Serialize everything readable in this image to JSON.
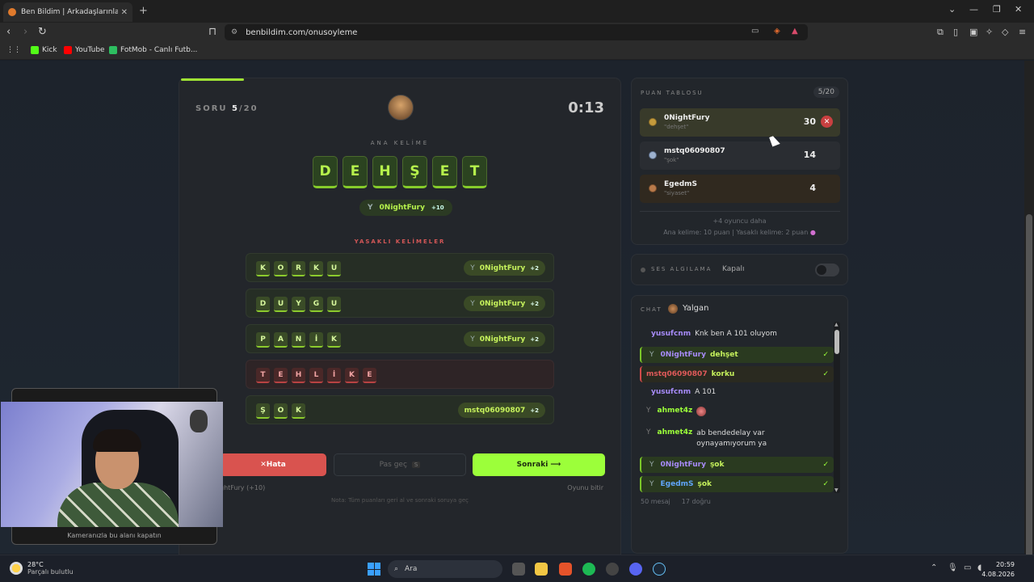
{
  "browser": {
    "tab_title": "Ben Bildim | Arkadaşlarınla Onlin",
    "tab_close": "✕",
    "new_tab": "+",
    "url": "benbildim.com/onusoyleme",
    "bookmarks": [
      "Kick",
      "YouTube",
      "FotMob - Canlı Futb..."
    ]
  },
  "game": {
    "soru_prefix": "SORU",
    "soru_current": "5",
    "soru_total": "/20",
    "timer": "0:13",
    "ana_label": "ANA KELİME",
    "main_word": [
      "D",
      "E",
      "H",
      "Ş",
      "E",
      "T"
    ],
    "main_guess": {
      "user": "0NightFury",
      "points": "+10"
    },
    "yasakli_label": "YASAKLI KELİMELER",
    "forbidden": [
      {
        "letters": [
          "K",
          "O",
          "R",
          "K",
          "U"
        ],
        "user": "0NightFury",
        "points": "+2",
        "found": true
      },
      {
        "letters": [
          "D",
          "U",
          "Y",
          "G",
          "U"
        ],
        "user": "0NightFury",
        "points": "+2",
        "found": true
      },
      {
        "letters": [
          "P",
          "A",
          "N",
          "İ",
          "K"
        ],
        "user": "0NightFury",
        "points": "+2",
        "found": true
      },
      {
        "letters": [
          "T",
          "E",
          "H",
          "L",
          "İ",
          "K",
          "E"
        ],
        "user": "",
        "points": "",
        "found": false
      },
      {
        "letters": [
          "Ş",
          "O",
          "K"
        ],
        "user": "mstq06090807",
        "points": "+2",
        "found": true
      }
    ],
    "buttons": {
      "hata": "Hata",
      "pas": "Pas geç",
      "pas_key": "S",
      "sonraki": "Sonraki ⟶"
    },
    "below_left": "ghtFury (+10)",
    "below_right": "Oyunu bitir",
    "note": "Not​a: Tüm puanları geri al ve sonraki soruya geç"
  },
  "scoreboard": {
    "label": "PUAN TABLOSU",
    "count": "5/20",
    "rows": [
      {
        "name": "0NightFury",
        "word": "\"dehşet\"",
        "score": "30"
      },
      {
        "name": "mstq06090807",
        "word": "\"şok\"",
        "score": "14"
      },
      {
        "name": "EgedmS",
        "word": "\"siyaset\"",
        "score": "4"
      }
    ],
    "more": "+4 oyuncu daha",
    "rule": "Ana kelime: 10 puan | Yasaklı kelime: 2 puan"
  },
  "ses": {
    "label": "SES ALGILAMA",
    "status": "Kapalı"
  },
  "chat": {
    "label": "CHAT",
    "user": "Yalgan",
    "messages": [
      {
        "type": "plain",
        "user": "yusufcnm",
        "text": "Knk ben A 101 oluyom",
        "color": "#a78bfa"
      },
      {
        "type": "guess",
        "user": "0NightFury",
        "text": "dehşet",
        "color": "#a78bfa"
      },
      {
        "type": "guess-red",
        "user": "mstq06090807",
        "text": "korku",
        "color": "#e05a5a"
      },
      {
        "type": "plain",
        "user": "yusufcnm",
        "text": "A 101",
        "color": "#a78bfa"
      },
      {
        "type": "sys",
        "user": "ahmet4z",
        "text": "",
        "color": "#9cff3a"
      },
      {
        "type": "sys2",
        "user": "ahmet4z",
        "text": "ab bendedelay var oynayamıyorum ya",
        "color": "#9cff3a"
      },
      {
        "type": "guess",
        "user": "0NightFury",
        "text": "şok",
        "color": "#a78bfa"
      },
      {
        "type": "guess",
        "user": "EgedmS",
        "text": "şok",
        "color": "#60a5fa"
      }
    ],
    "footer_msgs": "50 mesaj",
    "footer_correct": "17 doğru"
  },
  "camera": {
    "caption": "Kameranızla bu alanı kapatın"
  },
  "taskbar": {
    "temp": "28°C",
    "weather": "Parçalı bulutlu",
    "search": "Ara",
    "time": "20:59",
    "date": "4.08.2026"
  }
}
